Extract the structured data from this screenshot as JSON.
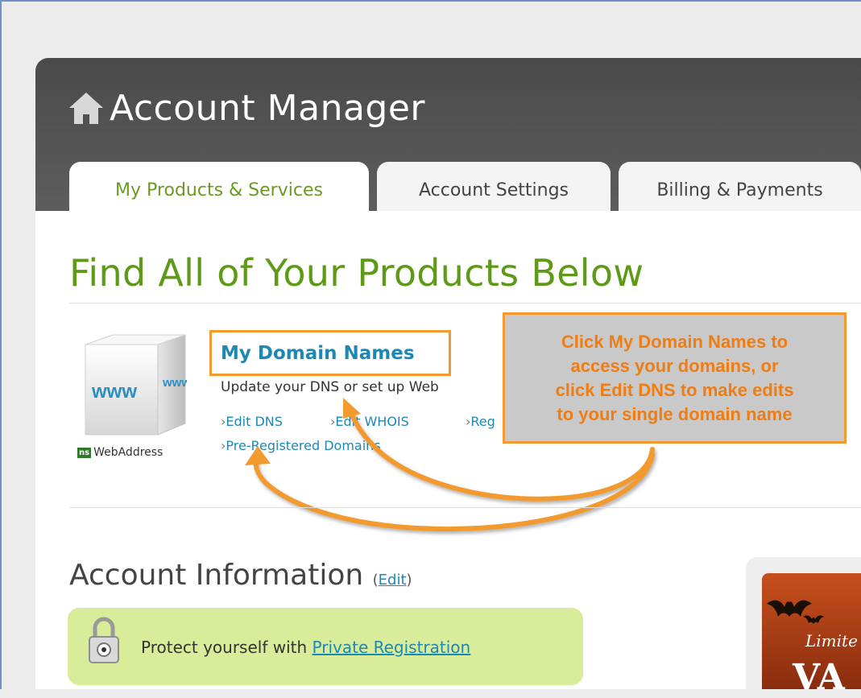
{
  "header": {
    "title": "Account Manager",
    "home_icon": "home-icon"
  },
  "tabs": [
    {
      "label": "My Products & Services",
      "active": true
    },
    {
      "label": "Account Settings",
      "active": false
    },
    {
      "label": "Billing & Payments",
      "active": false
    }
  ],
  "main": {
    "page_title": "Find All of Your Products Below",
    "product": {
      "name": "My Domain Names",
      "description": "Update your DNS or set up Web",
      "logo_text": "WebAddress",
      "logo_badge": "ns",
      "cube_text_front": "www",
      "cube_text_side": "www",
      "links": [
        {
          "label": "Edit DNS"
        },
        {
          "label": "Edit WHOIS"
        },
        {
          "label": "Reg"
        },
        {
          "label": "Pre-Registered Domains"
        }
      ]
    },
    "callout": {
      "lines": [
        "Click My Domain Names to",
        "access your domains, or",
        "click Edit DNS to make edits",
        "to your single domain name"
      ]
    },
    "account_info": {
      "title": "Account Information",
      "edit_open": "(",
      "edit_label": "Edit",
      "edit_close": ")",
      "notice_text": "Protect yourself with",
      "notice_link": "Private Registration"
    },
    "promo": {
      "text": "Limite",
      "big": "VA"
    }
  },
  "colors": {
    "accent_green": "#5e9a18",
    "link_blue": "#1e88b4",
    "callout_orange": "#f07d12",
    "header_gray": "#4a4a4a"
  }
}
